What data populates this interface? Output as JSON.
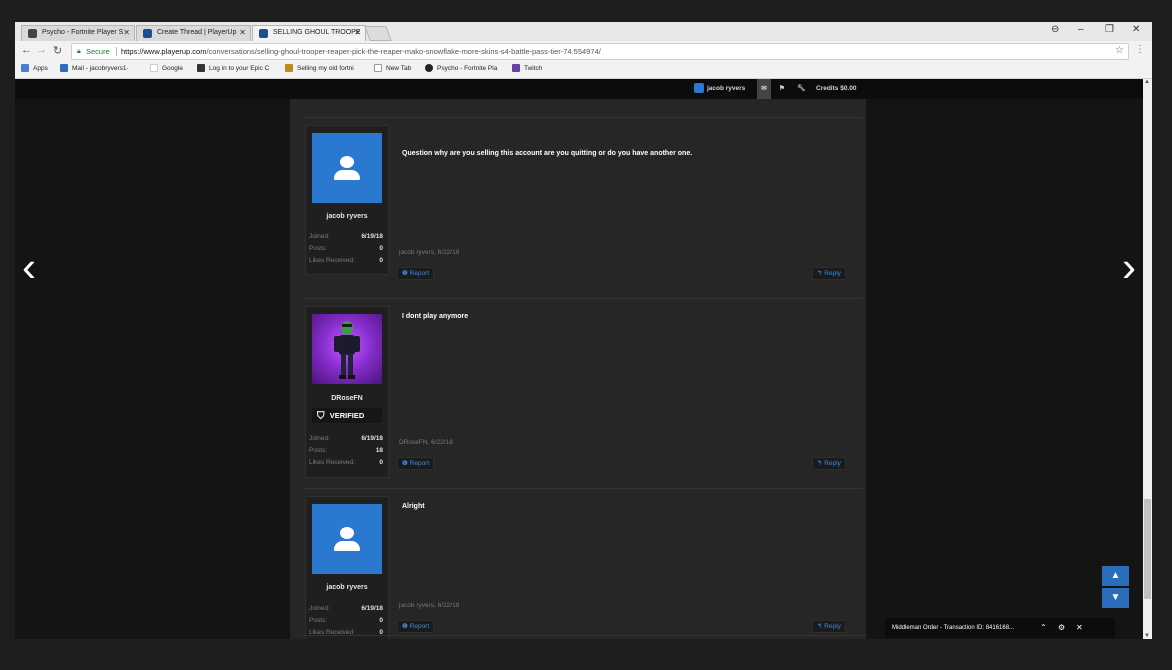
{
  "tabs": [
    {
      "title": "Psycho - Fortnite Player S",
      "favicon_color": "#444444"
    },
    {
      "title": "Create Thread | PlayerUp",
      "favicon_color": "#1e4f8c"
    },
    {
      "title": "SELLING GHOUL TROOPE",
      "favicon_color": "#1e4f8c"
    }
  ],
  "address_bar": {
    "secure_label": "Secure",
    "url_host": "https://www.playerup.com",
    "url_path": "/conversations/selling-ghoul-trooper-reaper-pick-the-reaper-mako-snowflake-more-skins-s4-battle-pass-tier-74.554974/"
  },
  "bookmarks": [
    {
      "label": "Apps",
      "color": "#4a7cd5"
    },
    {
      "label": "Mail - jacobryvers1·",
      "color": "#2a6ebb"
    },
    {
      "label": "Google",
      "color": "#ffffff"
    },
    {
      "label": "Log in to your Epic C",
      "color": "#333333"
    },
    {
      "label": "Selling my old fortni",
      "color": "#c08a1a"
    },
    {
      "label": "New Tab",
      "color": "#ffffff"
    },
    {
      "label": "Psycho - Fortnite Pla",
      "color": "#222222"
    },
    {
      "label": "Twitch",
      "color": "#6441a4"
    }
  ],
  "topbar": {
    "username": "jacob ryvers",
    "credits": "Credits $0.00"
  },
  "posts": [
    {
      "username": "jacob ryvers",
      "avatar": "default",
      "verified": false,
      "joined_label": "Joined:",
      "joined": "6/19/18",
      "posts_label": "Posts:",
      "posts": "0",
      "likes_label": "Likes Received:",
      "likes": "0",
      "message": "Question why are you selling this account are you quitting or do you have another one.",
      "meta": "jacob ryvers, 6/22/18",
      "report": "Report",
      "reply": "Reply"
    },
    {
      "username": "DRoseFN",
      "avatar": "skin",
      "verified": true,
      "verified_label": "VERIFIED",
      "joined_label": "Joined:",
      "joined": "6/19/18",
      "posts_label": "Posts:",
      "posts": "18",
      "likes_label": "Likes Received:",
      "likes": "0",
      "message": "I dont play anymore",
      "meta": "DRoseFN, 6/22/18",
      "report": "Report",
      "reply": "Reply"
    },
    {
      "username": "jacob ryvers",
      "avatar": "default",
      "verified": false,
      "joined_label": "Joined:",
      "joined": "6/19/18",
      "posts_label": "Posts:",
      "posts": "0",
      "likes_label": "Likes Received:",
      "likes": "0",
      "message": "Alright",
      "meta": "jacob ryvers, 6/22/18",
      "report": "Report",
      "reply": "Reply"
    }
  ],
  "middleman": {
    "text": "Middleman Order - Transaction ID: 8416168..."
  },
  "colors": {
    "accent": "#2b78d0",
    "link": "#3d8bde"
  }
}
